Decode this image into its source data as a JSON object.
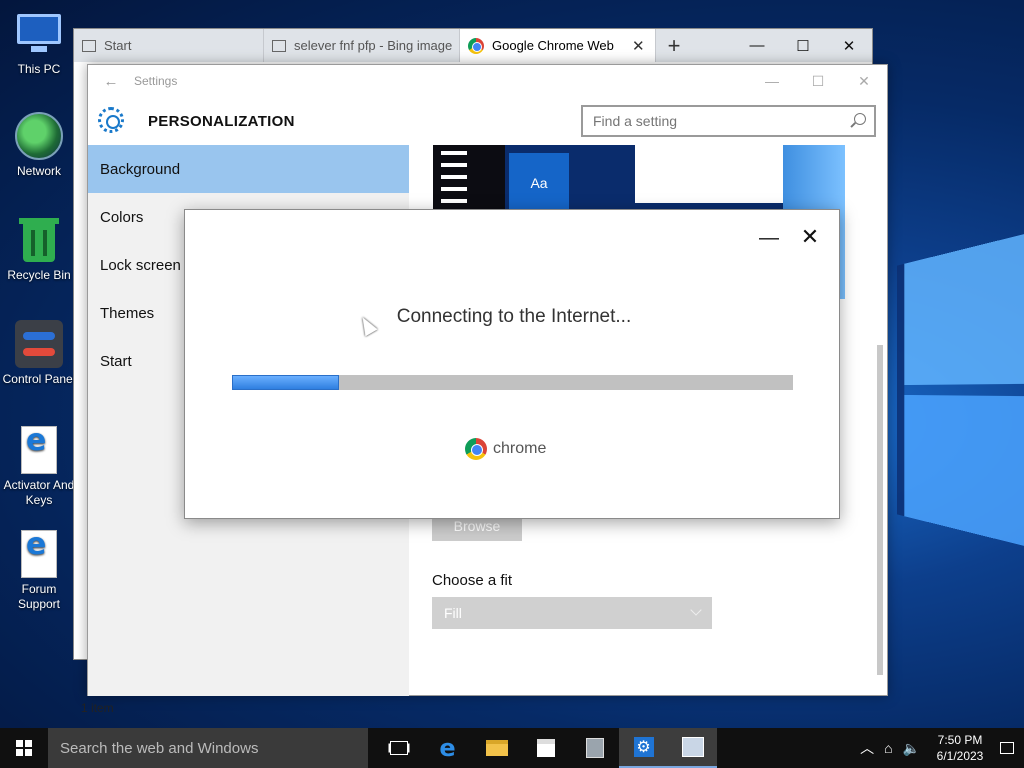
{
  "desktop": {
    "icons": [
      {
        "label": "This PC"
      },
      {
        "label": "Network"
      },
      {
        "label": "Recycle Bin"
      },
      {
        "label": "Control Panel"
      },
      {
        "label": "Activator And Keys"
      },
      {
        "label": "Forum Support"
      }
    ]
  },
  "explorer": {
    "tabs": [
      {
        "label": "Start"
      },
      {
        "label": "selever fnf pfp - Bing image"
      },
      {
        "label": "Google Chrome Web B"
      }
    ],
    "status": "1 item"
  },
  "settings": {
    "title": "Settings",
    "heading": "PERSONALIZATION",
    "search_placeholder": "Find a setting",
    "nav": [
      {
        "label": "Background"
      },
      {
        "label": "Colors"
      },
      {
        "label": "Lock screen"
      },
      {
        "label": "Themes"
      },
      {
        "label": "Start"
      }
    ],
    "preview_tile": "Aa",
    "browse_label": "Browse",
    "fit_label": "Choose a fit",
    "fit_value": "Fill"
  },
  "dialog": {
    "message": "Connecting to the Internet...",
    "progress_fraction": 0.19,
    "brand": "chrome"
  },
  "taskbar": {
    "search_placeholder": "Search the web and Windows",
    "time": "7:50 PM",
    "date": "6/1/2023"
  },
  "colors": {
    "accent": "#99c5ee",
    "progress": "#2f7fe0"
  }
}
